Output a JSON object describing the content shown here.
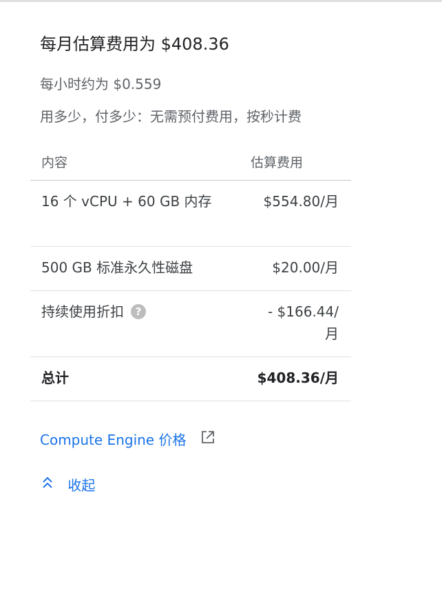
{
  "summary": {
    "title": "每月估算费用为 $408.36",
    "hourly": "每小时约为 $0.559",
    "payg": "用多少，付多少：无需预付费用，按秒计费"
  },
  "table": {
    "headers": {
      "item": "内容",
      "cost": "估算费用"
    },
    "rows": [
      {
        "item": "16 个 vCPU + 60 GB 内存",
        "cost": "$554.80/月"
      },
      {
        "item": "500 GB 标准永久性磁盘",
        "cost": "$20.00/月"
      },
      {
        "item": "持续使用折扣",
        "cost": "- $166.44/月",
        "help": "?"
      }
    ],
    "total": {
      "item": "总计",
      "cost": "$408.36/月"
    }
  },
  "links": {
    "pricing": "Compute Engine 价格",
    "collapse": "收起"
  },
  "icons": {
    "external": "external-link-icon",
    "collapse": "chevron-up-double-icon",
    "help": "help-circle-icon"
  },
  "colors": {
    "link": "#1a73e8",
    "text": "#202124",
    "muted": "#5f6368"
  }
}
